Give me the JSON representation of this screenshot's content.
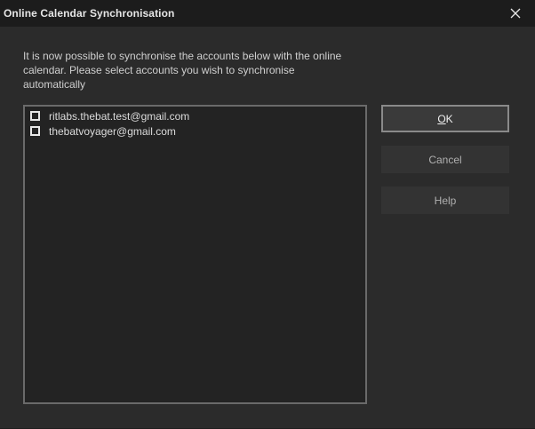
{
  "window": {
    "title": "Online Calendar Synchronisation",
    "close_icon": "close-icon"
  },
  "intro": {
    "text": "It is now possible to synchronise the accounts below with the online calendar. Please select accounts you wish to synchronise automatically"
  },
  "accounts": [
    {
      "label": "ritlabs.thebat.test@gmail.com",
      "checked": false
    },
    {
      "label": "thebatvoyager@gmail.com",
      "checked": false
    }
  ],
  "buttons": {
    "ok_accel": "O",
    "ok_rest": "K",
    "cancel_label": "Cancel",
    "help_label": "Help"
  },
  "colors": {
    "background": "#2b2b2b",
    "titlebar": "#1c1c1c",
    "list_background": "#232323"
  }
}
